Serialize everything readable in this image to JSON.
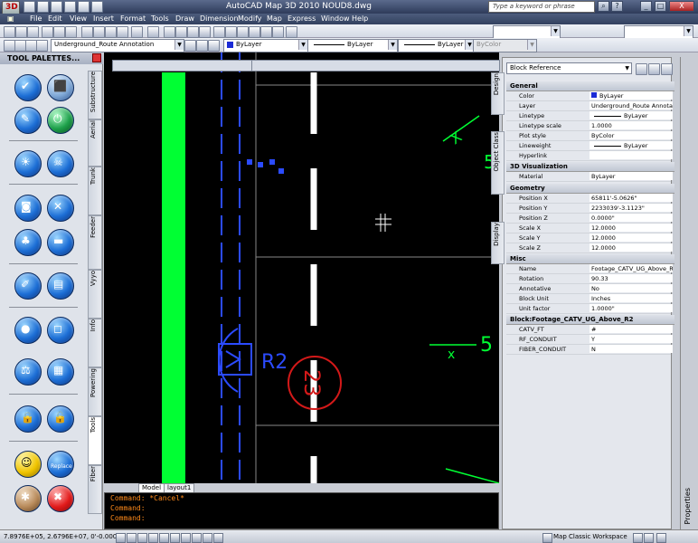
{
  "window": {
    "title": "AutoCAD Map 3D 2010    NOUD8.dwg",
    "app_button": "3D",
    "search_placeholder": "Type a keyword or phrase",
    "controls": [
      "_",
      "□",
      "X"
    ]
  },
  "menu": [
    "File",
    "Edit",
    "View",
    "Insert",
    "Format",
    "Tools",
    "Draw",
    "Dimension",
    "Modify",
    "Map",
    "Express",
    "Window",
    "Help"
  ],
  "toolbar": {
    "layer_combo": "Underground_Route Annotation",
    "color_combo": "ByLayer",
    "linetype_combo": "ByLayer",
    "lineweight_combo": "ByLayer",
    "plotstyle_combo": "ByColor"
  },
  "palette": {
    "title": "TOOL PALETTES...",
    "tabs": [
      "Substructure",
      "Aerial",
      "Trunk",
      "Feeder",
      "Vyyo",
      "Info",
      "Powering",
      "Tools",
      "Fiber"
    ],
    "buttons": [
      {
        "name": "check-icon"
      },
      {
        "name": "cube-icon"
      },
      {
        "name": "wand-icon"
      },
      {
        "name": "power-icon"
      },
      {
        "name": "sun-icon"
      },
      {
        "name": "skull-icon"
      },
      {
        "name": "cylinder-icon"
      },
      {
        "name": "cross-icon"
      },
      {
        "name": "tree-icon"
      },
      {
        "name": "ruler-icon"
      },
      {
        "name": "brush-icon"
      },
      {
        "name": "printer-icon"
      },
      {
        "name": "sphere-icon"
      },
      {
        "name": "square-icon"
      },
      {
        "name": "scale-icon"
      },
      {
        "name": "grid-icon"
      },
      {
        "name": "lock-icon"
      },
      {
        "name": "unlock-icon"
      },
      {
        "name": "smiley-icon"
      },
      {
        "name": "replace-icon"
      },
      {
        "name": "bug-icon"
      },
      {
        "name": "x-circle-icon"
      }
    ],
    "replace_label": "Replace"
  },
  "drawing": {
    "tag_r2": "R2",
    "tag_23": "23",
    "tag_5": "5",
    "tag_x": "X",
    "tag_x2": "x"
  },
  "layout_tabs": [
    "Model",
    "layout1"
  ],
  "command_lines": [
    "Command: *Cancel*",
    "Command:",
    "Command:"
  ],
  "properties": {
    "selection": "Block Reference",
    "side_tabs": [
      "Design",
      "Object Class",
      "Display"
    ],
    "vertical_label": "Properties",
    "sections": [
      {
        "title": "General",
        "rows": [
          {
            "k": "Color",
            "v": "ByLayer"
          },
          {
            "k": "Layer",
            "v": "Underground_Route Annota..."
          },
          {
            "k": "Linetype",
            "v": "ByLayer"
          },
          {
            "k": "Linetype scale",
            "v": "1.0000"
          },
          {
            "k": "Plot style",
            "v": "ByColor"
          },
          {
            "k": "Lineweight",
            "v": "ByLayer"
          },
          {
            "k": "Hyperlink",
            "v": ""
          }
        ]
      },
      {
        "title": "3D Visualization",
        "rows": [
          {
            "k": "Material",
            "v": "ByLayer"
          }
        ]
      },
      {
        "title": "Geometry",
        "rows": [
          {
            "k": "Position X",
            "v": "65811'-5.0626\""
          },
          {
            "k": "Position Y",
            "v": "2233039'-3.1123\""
          },
          {
            "k": "Position Z",
            "v": "0.0000\""
          },
          {
            "k": "Scale X",
            "v": "12.0000"
          },
          {
            "k": "Scale Y",
            "v": "12.0000"
          },
          {
            "k": "Scale Z",
            "v": "12.0000"
          }
        ]
      },
      {
        "title": "Misc",
        "rows": [
          {
            "k": "Name",
            "v": "Footage_CATV_UG_Above_R2"
          },
          {
            "k": "Rotation",
            "v": "90.33"
          },
          {
            "k": "Annotative",
            "v": "No"
          },
          {
            "k": "Block Unit",
            "v": "Inches"
          },
          {
            "k": "Unit factor",
            "v": "1.0000\""
          }
        ]
      },
      {
        "title": "Block:Footage_CATV_UG_Above_R2",
        "rows": [
          {
            "k": "CATV_FT",
            "v": "#"
          },
          {
            "k": "RF_CONDUIT",
            "v": "Y"
          },
          {
            "k": "FIBER_CONDUIT",
            "v": "N"
          }
        ]
      }
    ]
  },
  "status": {
    "coords": "7.8976E+05, 2.6796E+07, 0'-0.0000\"",
    "workspace": "Map Classic Workspace"
  },
  "colors": {
    "accent": "#00ff33",
    "line": "#2b4bff",
    "red": "#d31919",
    "cmd": "#ff8a1a"
  }
}
